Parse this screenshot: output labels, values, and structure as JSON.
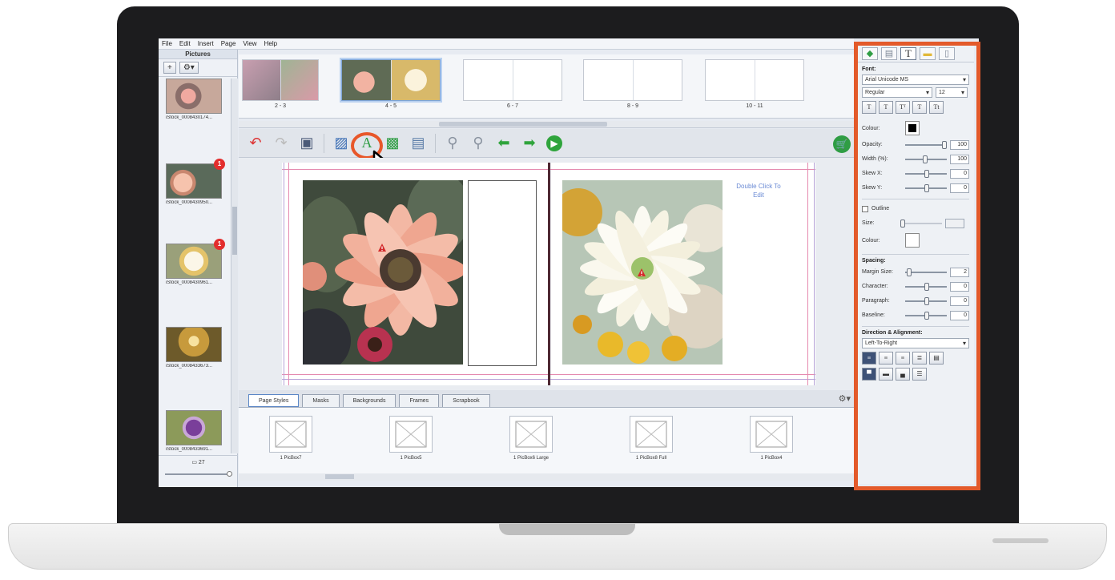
{
  "menu": [
    "File",
    "Edit",
    "Insert",
    "Page",
    "View",
    "Help"
  ],
  "left_panel": {
    "title": "Pictures",
    "add_label": "+",
    "gear_label": "⚙▾",
    "thumbnails": [
      {
        "caption": "iStock_000843017​4...",
        "badge": ""
      },
      {
        "caption": "iStock_000843095​0...",
        "badge": "1"
      },
      {
        "caption": "iStock_000843096​1...",
        "badge": "1"
      },
      {
        "caption": "iStock_000843367​3...",
        "badge": ""
      },
      {
        "caption": "iStock_000843369​1...",
        "badge": ""
      }
    ],
    "count": "27"
  },
  "spreads": [
    {
      "label": "2 - 3"
    },
    {
      "label": "4 - 5"
    },
    {
      "label": "6 - 7"
    },
    {
      "label": "8 - 9"
    },
    {
      "label": "10 - 11"
    }
  ],
  "canvas": {
    "double_click_text": "Double Click To Edit"
  },
  "bottom_tabs": [
    "Page Styles",
    "Masks",
    "Backgrounds",
    "Frames",
    "Scrapbook"
  ],
  "page_styles": [
    "1 PicBox7",
    "1 PicBox5",
    "1 PicBox6 Large",
    "1 PicBox8 Full",
    "1 PicBox4"
  ],
  "right_panel": {
    "font_label": "Font:",
    "font_name": "Arial Unicode MS",
    "font_style": "Regular",
    "font_size": "12",
    "format_buttons": [
      "T",
      "T",
      "Tᵀ",
      "T",
      "Tt"
    ],
    "colour_label": "Colour:",
    "opacity_label": "Opacity:",
    "opacity_value": "100",
    "width_label": "Width (%):",
    "width_value": "100",
    "skewx_label": "Skew X:",
    "skewx_value": "0",
    "skewy_label": "Skew Y:",
    "skewy_value": "0",
    "outline_label": "Outline",
    "size_label": "Size:",
    "outline_colour_label": "Colour:",
    "spacing_label": "Spacing:",
    "margin_label": "Margin Size:",
    "margin_value": "2",
    "character_label": "Character:",
    "character_value": "0",
    "paragraph_label": "Paragraph:",
    "paragraph_value": "0",
    "baseline_label": "Baseline:",
    "baseline_value": "0",
    "direction_label": "Direction & Alignment:",
    "direction_value": "Left-To-Right"
  },
  "colors": {
    "highlight": "#e35a2a",
    "bezel": "#1c1c1e"
  }
}
